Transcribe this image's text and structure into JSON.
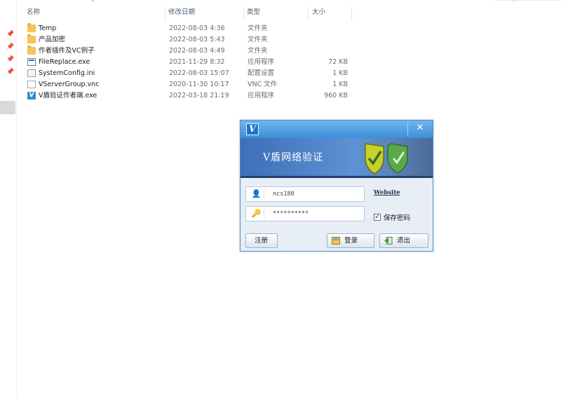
{
  "explorer": {
    "columns": {
      "name": "名称",
      "date": "修改日期",
      "type": "类型",
      "size": "大小"
    },
    "files": [
      {
        "name": "Temp",
        "date": "2022-08-03 4:36",
        "type": "文件夹",
        "size": "",
        "icon": "folder-icon"
      },
      {
        "name": "产品加密",
        "date": "2022-08-03 5:43",
        "type": "文件夹",
        "size": "",
        "icon": "folder-icon"
      },
      {
        "name": "作者插件及VC例子",
        "date": "2022-08-03 4:49",
        "type": "文件夹",
        "size": "",
        "icon": "folder-icon"
      },
      {
        "name": "FileReplace.exe",
        "date": "2021-11-29 8:32",
        "type": "应用程序",
        "size": "72 KB",
        "icon": "exe-icon"
      },
      {
        "name": "SystemConfig.ini",
        "date": "2022-08-03 15:07",
        "type": "配置设置",
        "size": "1 KB",
        "icon": "ini-file-icon"
      },
      {
        "name": "VServerGroup.vnc",
        "date": "2020-11-30 10:17",
        "type": "VNC 文件",
        "size": "1 KB",
        "icon": "vnc-file-icon"
      },
      {
        "name": "V盾验证作者端.exe",
        "date": "2022-03-18 21:19",
        "type": "应用程序",
        "size": "960 KB",
        "icon": "v-app-icon"
      }
    ]
  },
  "dialog": {
    "logo_glyph": "V",
    "close_glyph": "✕",
    "banner_title": "V盾网络验证",
    "username": "ncs180",
    "password": "**********",
    "website_link": "Website",
    "remember_checked": true,
    "remember_label": "保存密码",
    "register_label": "注册",
    "login_label": "登录",
    "exit_label": "退出"
  },
  "colors": {
    "titlebar": "#3c8fd8",
    "banner": "#3e6fb8",
    "folder": "#f3c55a",
    "shield_yellow": "#c8d12a",
    "shield_green": "#5aa84a"
  }
}
